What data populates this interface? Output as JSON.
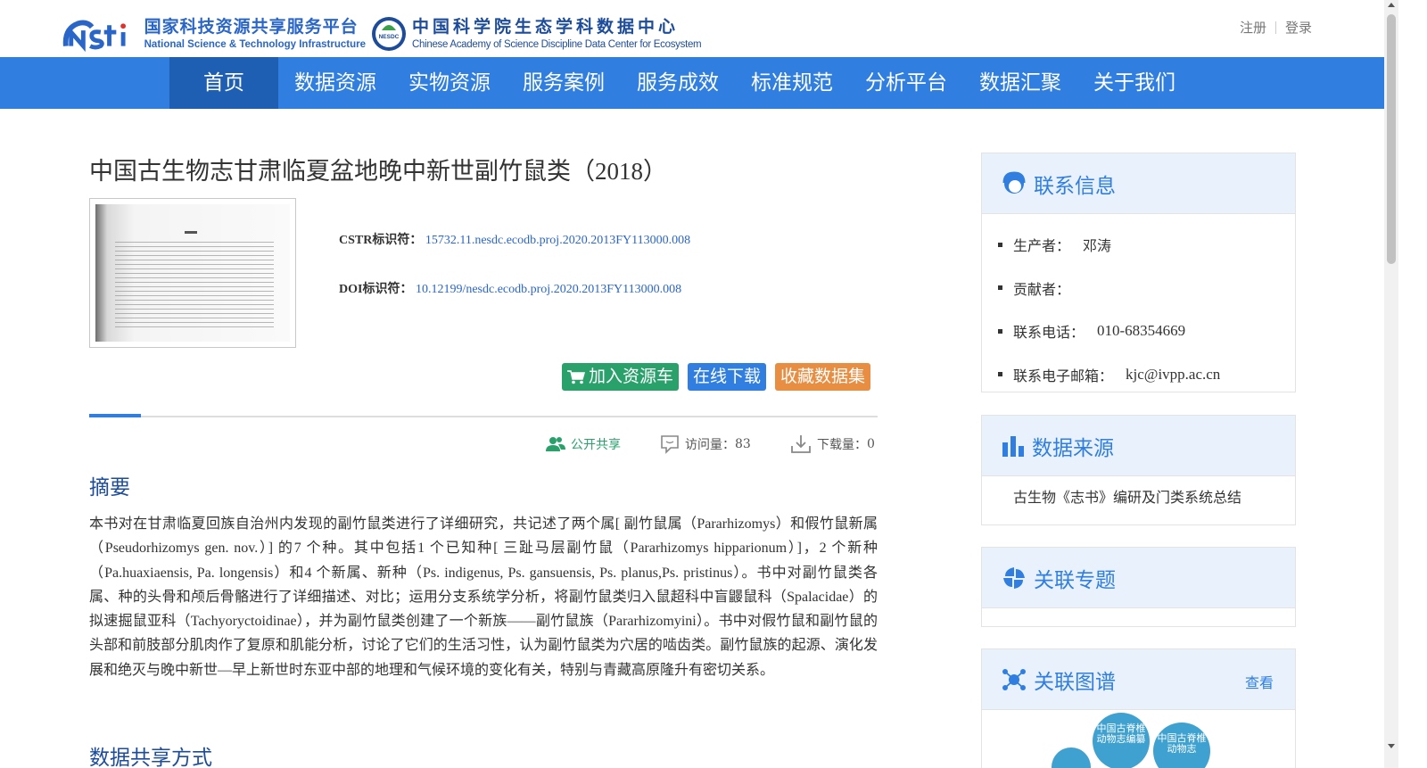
{
  "header": {
    "logo1_cn": "国家科技资源共享服务平台",
    "logo1_en": "National Science & Technology Infrastructure",
    "logo2_badge": "NESDC",
    "logo2_cn": "中国科学院生态学科数据中心",
    "logo2_en": "Chinese Academy of Science Discipline Data Center for Ecosystem",
    "register": "注册",
    "login": "登录"
  },
  "nav": {
    "items": [
      {
        "label": "首页",
        "active": true
      },
      {
        "label": "数据资源"
      },
      {
        "label": "实物资源"
      },
      {
        "label": "服务案例"
      },
      {
        "label": "服务成效"
      },
      {
        "label": "标准规范"
      },
      {
        "label": "分析平台"
      },
      {
        "label": "数据汇聚"
      },
      {
        "label": "关于我们"
      }
    ]
  },
  "dataset": {
    "title": "中国古生物志甘肃临夏盆地晚中新世副竹鼠类",
    "title_year": "（2018）",
    "cstr_label": "CSTR标识符：",
    "cstr_value": "15732.11.nesdc.ecodb.proj.2020.2013FY113000.008",
    "doi_label": "DOI标识符：",
    "doi_value": "10.12199/nesdc.ecodb.proj.2020.2013FY113000.008"
  },
  "actions": {
    "add_cart": "加入资源车",
    "download": "在线下载",
    "favorite": "收藏数据集"
  },
  "stats": {
    "share": "公开共享",
    "visits_label": "访问量：",
    "visits": "83",
    "downloads_label": "下载量：",
    "downloads": "0"
  },
  "abstract": {
    "heading": "摘要",
    "text": "本书对在甘肃临夏回族自治州内发现的副竹鼠类进行了详细研究，共记述了两个属[ 副竹鼠属（Pararhizomys）和假竹鼠新属（Pseudorhizomys gen. nov.）] 的7 个种。其中包括1 个已知种[ 三趾马层副竹鼠（Pararhizomys hipparionum）]，2 个新种（Pa.huaxiaensis, Pa. longensis）和4 个新属、新种（Ps. indigenus, Ps. gansuensis, Ps. planus,Ps. pristinus）。书中对副竹鼠类各属、种的头骨和颅后骨骼进行了详细描述、对比；运用分支系统学分析，将副竹鼠类归入鼠超科中盲鼹鼠科（Spalacidae）的拟速掘鼠亚科（Tachyoryctoidinae），并为副竹鼠类创建了一个新族——副竹鼠族（Pararhizomyini）。书中对假竹鼠和副竹鼠的头部和前肢部分肌肉作了复原和肌能分析，讨论了它们的生活习性，认为副竹鼠类为穴居的啮齿类。副竹鼠族的起源、演化发展和绝灭与晚中新世—早上新世时东亚中部的地理和气候环境的变化有关，特别与青藏高原隆升有密切关系。"
  },
  "share_section": {
    "heading": "数据共享方式"
  },
  "contact": {
    "title": "联系信息",
    "producer_label": "生产者：",
    "producer": "邓涛",
    "contributor_label": "贡献者：",
    "contributor": "",
    "phone_label": "联系电话：",
    "phone": "010-68354669",
    "email_label": "联系电子邮箱：",
    "email": "kjc@ivpp.ac.cn"
  },
  "source": {
    "title": "数据来源",
    "text": "古生物《志书》编研及门类系统总结"
  },
  "topic": {
    "title": "关联专题"
  },
  "graph": {
    "title": "关联图谱",
    "view": "查看",
    "nodes": [
      "中国古脊椎动物志编纂",
      "中国古脊椎动物志"
    ]
  },
  "colors": {
    "nav_bg": "#2f7ee0",
    "nav_active": "#1f5fb3",
    "cart_btn": "#2aa06b",
    "download_btn": "#2f7ee0",
    "favorite_btn": "#e78e42",
    "heading_blue": "#1d4c9a",
    "panel_head_bg": "#e9f2fc"
  }
}
